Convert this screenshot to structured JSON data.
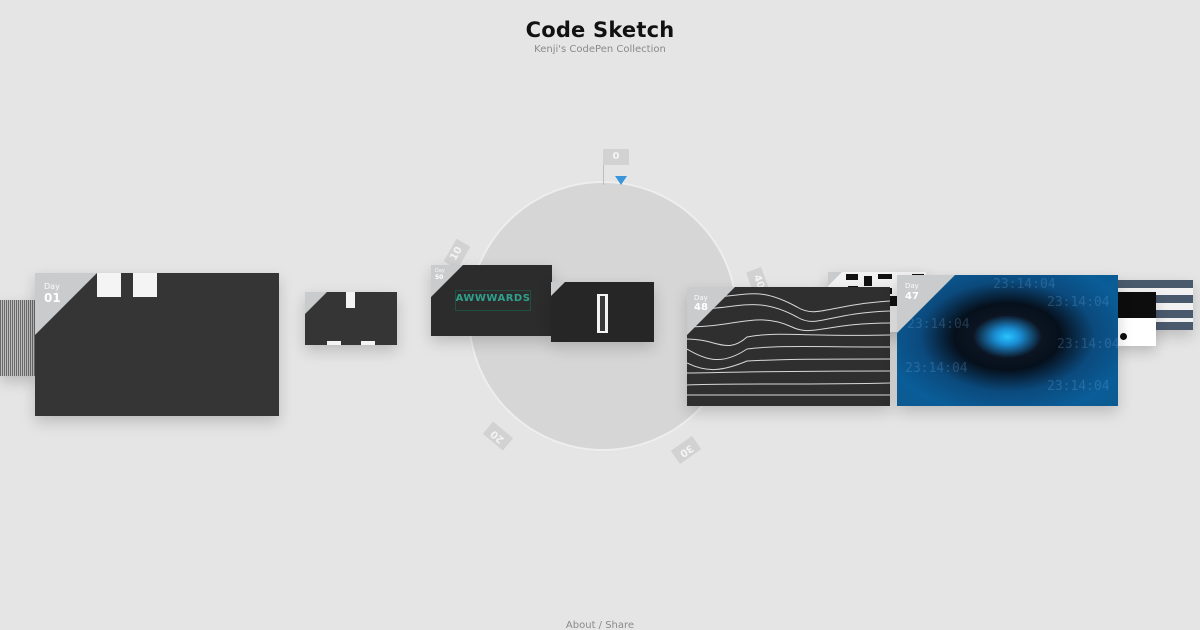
{
  "header": {
    "title": "Code Sketch",
    "subtitle": "Kenji's CodePen Collection"
  },
  "footer": {
    "links_text": "About / Share"
  },
  "dial": {
    "ticks": [
      "0",
      "10",
      "20",
      "30",
      "40"
    ],
    "pointer_color": "#3b95db"
  },
  "cards": [
    {
      "day_label": "Day",
      "day_number": "01"
    },
    {
      "day_label": "Day",
      "day_number": "48"
    },
    {
      "day_label": "Day",
      "day_number": "47"
    },
    {
      "day_label": "Day",
      "day_number": "50",
      "content_text": "AWWWARDS"
    }
  ],
  "day47_text": "23:14:04",
  "colors": {
    "background": "#e5e5e5",
    "card": "#353535",
    "corner": "#c9cbcd",
    "accent": "#3b95db"
  }
}
